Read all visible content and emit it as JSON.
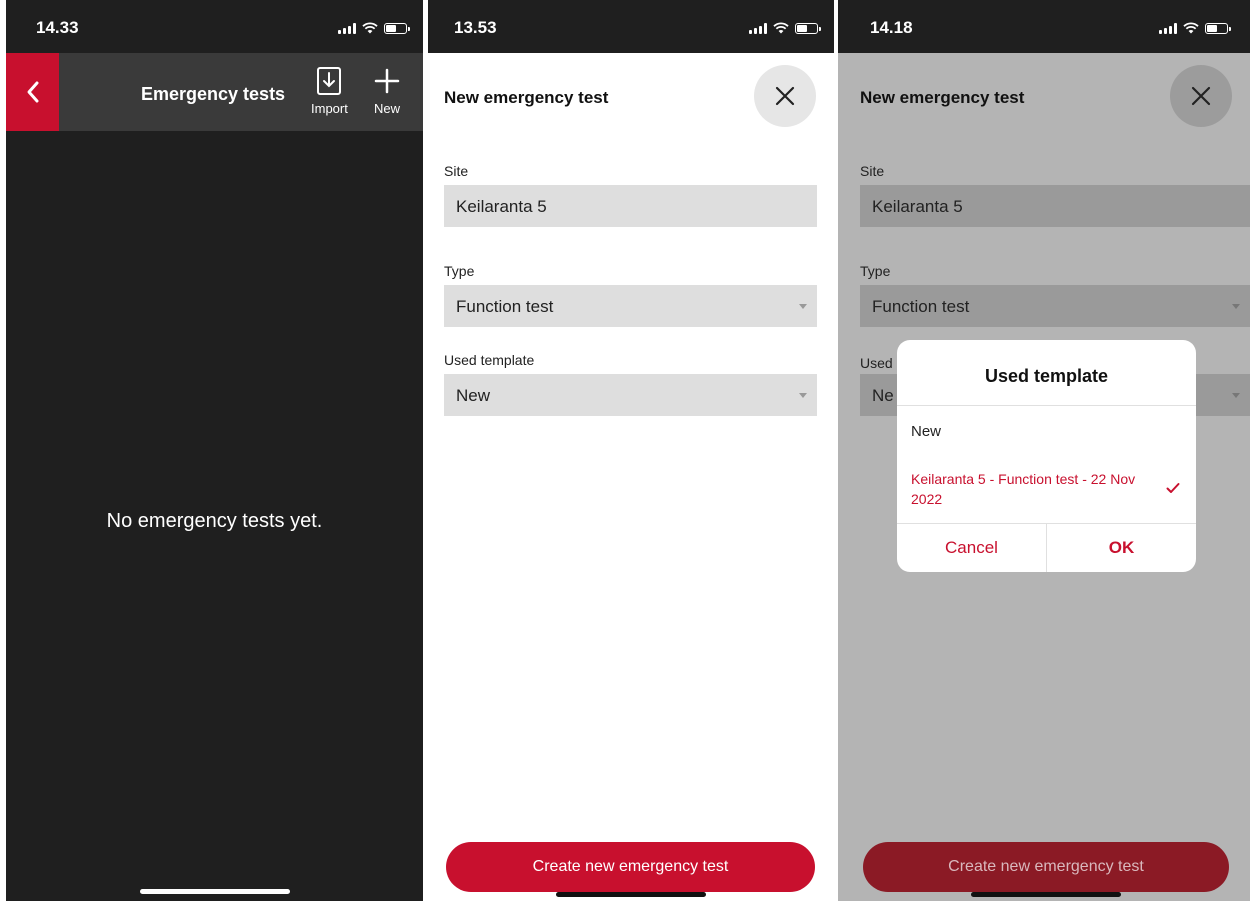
{
  "screen1": {
    "status": {
      "time": "14.33"
    },
    "nav": {
      "title": "Emergency tests",
      "import_label": "Import",
      "new_label": "New"
    },
    "empty_text": "No emergency tests yet."
  },
  "screen2": {
    "status": {
      "time": "13.53"
    },
    "title": "New emergency test",
    "site": {
      "label": "Site",
      "value": "Keilaranta 5"
    },
    "type": {
      "label": "Type",
      "value": "Function test"
    },
    "template": {
      "label": "Used template",
      "value": "New"
    },
    "create_button": "Create new emergency test"
  },
  "screen3": {
    "status": {
      "time": "14.18"
    },
    "title": "New emergency test",
    "site": {
      "label": "Site",
      "value": "Keilaranta 5"
    },
    "type": {
      "label": "Type",
      "value": "Function test"
    },
    "template": {
      "label_partial": "Used",
      "value_partial": "Ne"
    },
    "dialog": {
      "title": "Used template",
      "options": [
        "New",
        "Keilaranta 5 - Function test - 22 Nov 2022"
      ],
      "selected_index": 1,
      "cancel": "Cancel",
      "ok": "OK"
    },
    "create_button": "Create new emergency test"
  },
  "colors": {
    "accent": "#c8102e",
    "dark_bg": "#1f1f1f",
    "navbar": "#3a3a3a"
  },
  "icons": [
    "chevron-left-icon",
    "import-icon",
    "plus-icon",
    "close-icon",
    "checkmark-icon",
    "signal-icon",
    "wifi-icon",
    "battery-icon"
  ]
}
